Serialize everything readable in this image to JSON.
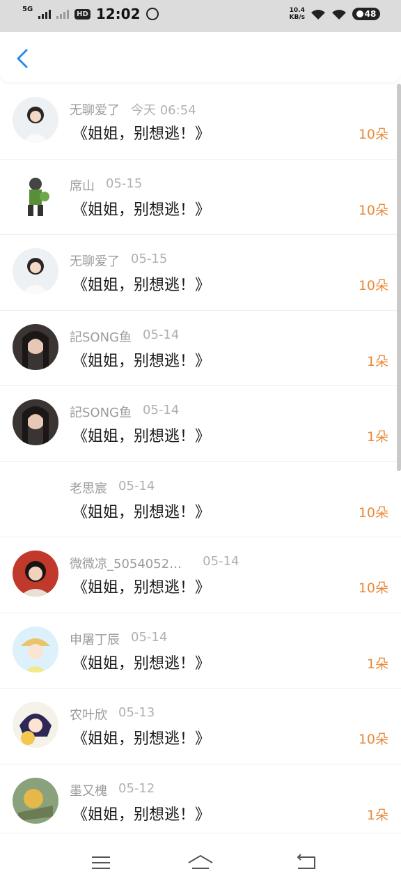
{
  "status_bar": {
    "network": "5G",
    "time": "12:02",
    "hd": "HD",
    "speed_value": "10.4",
    "speed_unit": "KB/s",
    "battery": "48"
  },
  "header": {
    "back_icon": "chevron-left-icon",
    "accent": "#2b8ae8"
  },
  "accent_orange": "#e98a3a",
  "records": [
    {
      "name": "无聊爱了",
      "date": "今天 06:54",
      "title": "《姐姐，别想逃！》",
      "count": "10朵"
    },
    {
      "name": "席山",
      "date": "05-15",
      "title": "《姐姐，别想逃！》",
      "count": "10朵"
    },
    {
      "name": "无聊爱了",
      "date": "05-15",
      "title": "《姐姐，别想逃！》",
      "count": "10朵"
    },
    {
      "name": "記SONG鱼",
      "date": "05-14",
      "title": "《姐姐，别想逃！》",
      "count": "1朵"
    },
    {
      "name": "記SONG鱼",
      "date": "05-14",
      "title": "《姐姐，别想逃！》",
      "count": "1朵"
    },
    {
      "name": "老思宸",
      "date": "05-14",
      "title": "《姐姐，别想逃！》",
      "count": "10朵"
    },
    {
      "name": "微微凉_5054052…",
      "date": "05-14",
      "title": "《姐姐，别想逃！》",
      "count": "10朵"
    },
    {
      "name": "申屠丁辰",
      "date": "05-14",
      "title": "《姐姐，别想逃！》",
      "count": "1朵"
    },
    {
      "name": "农叶欣",
      "date": "05-13",
      "title": "《姐姐，别想逃！》",
      "count": "10朵"
    },
    {
      "name": "墨又槐",
      "date": "05-12",
      "title": "《姐姐，别想逃！》",
      "count": "1朵"
    }
  ],
  "nav": {
    "menu_icon": "menu-icon",
    "home_icon": "home-icon",
    "back_icon": "back-icon"
  }
}
